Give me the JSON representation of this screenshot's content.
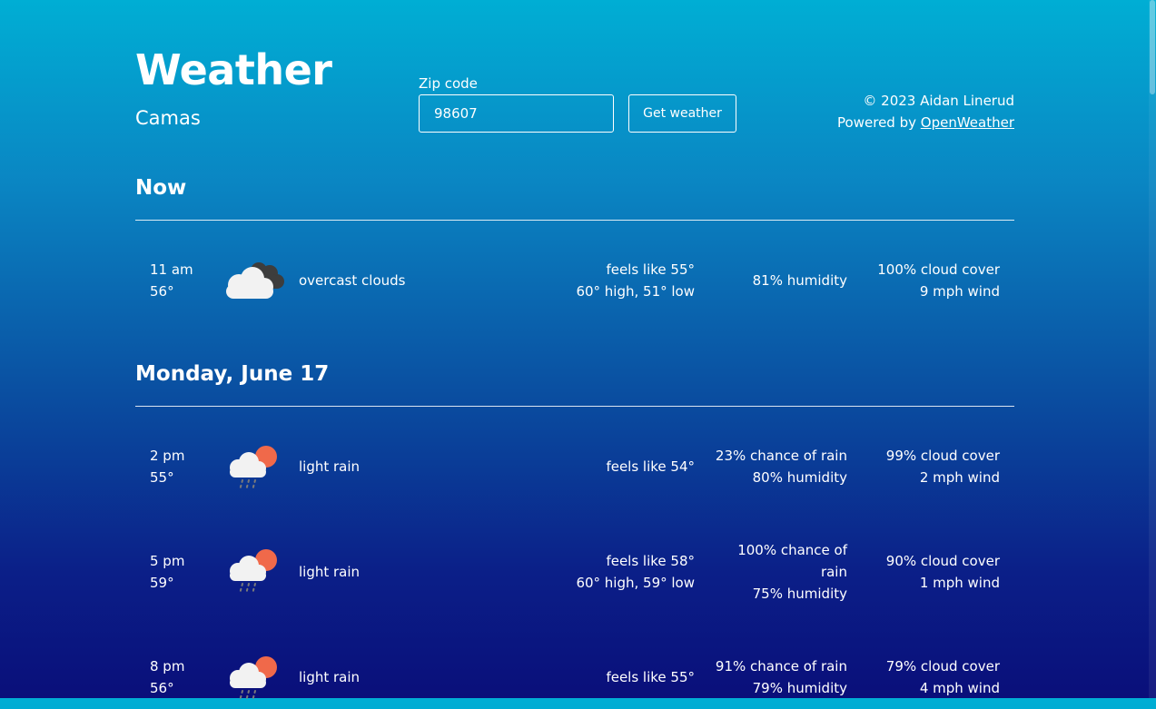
{
  "header": {
    "title": "Weather",
    "city": "Camas"
  },
  "search": {
    "label": "Zip code",
    "value": "98607",
    "button_label": "Get weather"
  },
  "credits": {
    "copyright": "© 2023 Aidan Linerud",
    "powered_prefix": "Powered by ",
    "powered_link": "OpenWeather"
  },
  "now": {
    "heading": "Now",
    "time": "11 am",
    "temp": "56°",
    "icon": "overcast-clouds-icon",
    "description": "overcast clouds",
    "feels_like": "feels like 55°",
    "high_low": "60° high, 51° low",
    "humidity": "81% humidity",
    "cloud_cover": "100% cloud cover",
    "wind": "9 mph wind"
  },
  "day": {
    "heading": "Monday, June 17",
    "rows": [
      {
        "time": "2 pm",
        "temp": "55°",
        "icon": "light-rain-icon",
        "description": "light rain",
        "feels_like": "feels like 54°",
        "chance": "23% chance of rain",
        "humidity": "80% humidity",
        "cloud_cover": "99% cloud cover",
        "wind": "2 mph wind"
      },
      {
        "time": "5 pm",
        "temp": "59°",
        "icon": "light-rain-icon",
        "description": "light rain",
        "feels_like": "feels like 58°",
        "high_low": "60° high, 59° low",
        "chance": "100% chance of rain",
        "humidity": "75% humidity",
        "cloud_cover": "90% cloud cover",
        "wind": "1 mph wind"
      },
      {
        "time": "8 pm",
        "temp": "56°",
        "icon": "light-rain-icon",
        "description": "light rain",
        "feels_like": "feels like 55°",
        "chance": "91% chance of rain",
        "humidity": "79% humidity",
        "cloud_cover": "79% cloud cover",
        "wind": "4 mph wind"
      }
    ]
  },
  "colors": {
    "sun": "#f0694a",
    "cloud_light": "#f2f2f2",
    "cloud_dark": "#3d3d3d",
    "rain": "#7a7a7a"
  }
}
